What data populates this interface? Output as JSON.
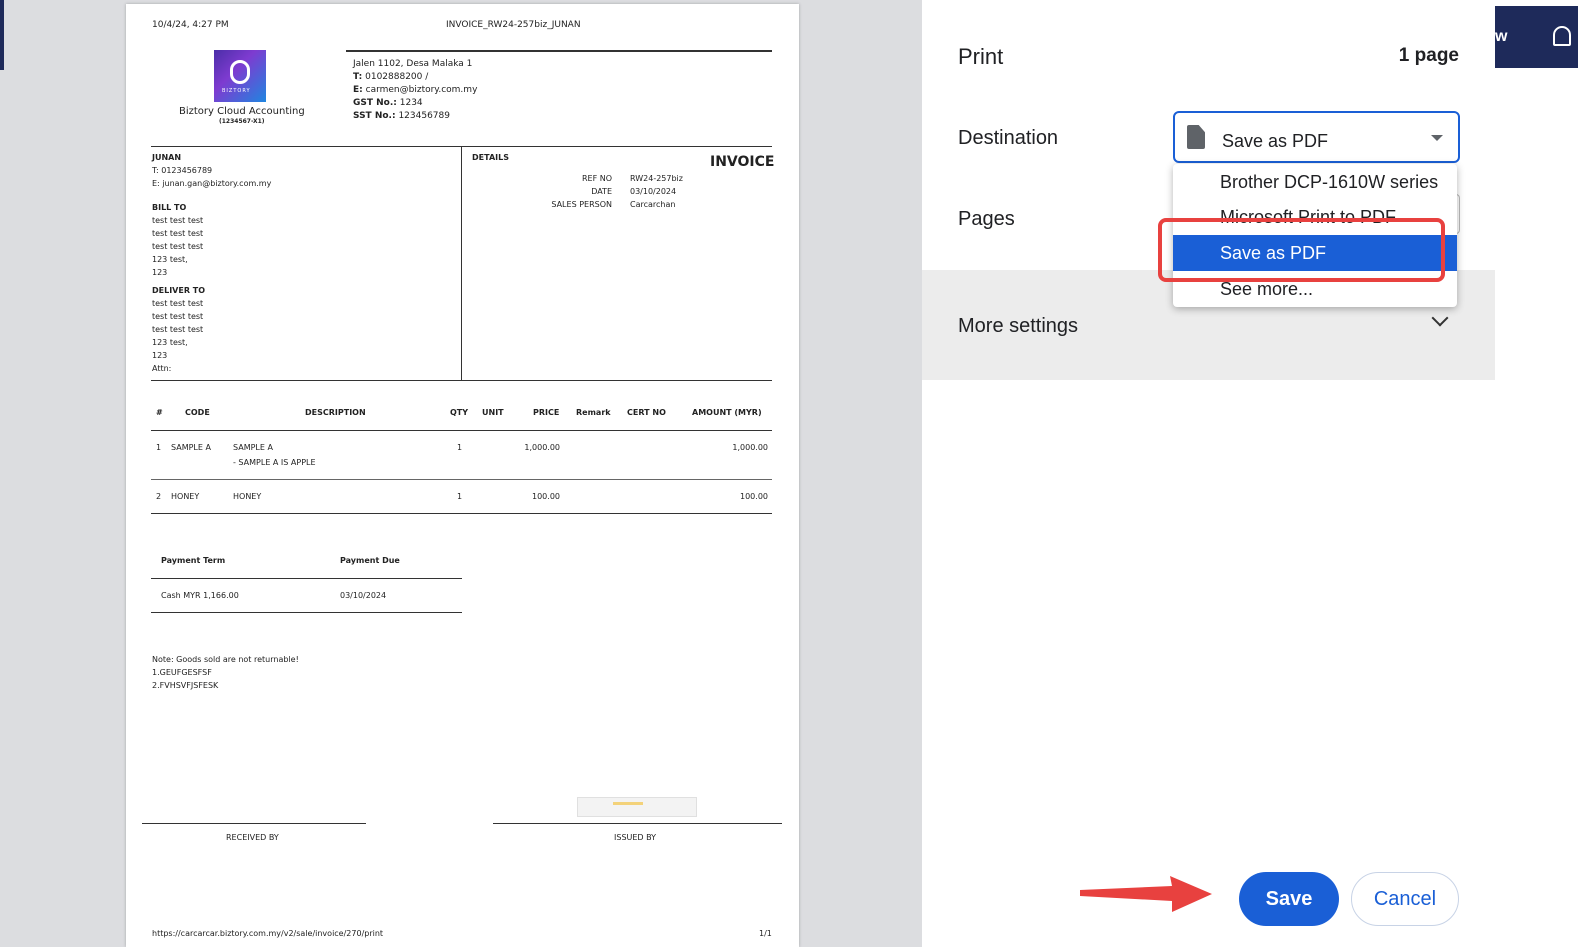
{
  "doc": {
    "header_datetime": "10/4/24, 4:27 PM",
    "header_title": "INVOICE_RW24-257biz_JUNAN",
    "logo_text": "BIZTORY",
    "company_name": "Biztory Cloud Accounting",
    "company_reg": "(1234567-X1)",
    "address": "Jalen 1102, Desa Malaka 1",
    "phone_label": "T:",
    "phone": "0102888200 /",
    "email_label": "E:",
    "email": "carmen@biztory.com.my",
    "gst_label": "GST No.:",
    "gst": "1234",
    "sst_label": "SST No.:",
    "sst": "123456789",
    "customer_name": "JUNAN",
    "customer_phone": "T: 0123456789",
    "customer_email": "E: junan.gan@biztory.com.my",
    "bill_to_label": "BILL TO",
    "bill_to": [
      "test test test",
      "test test test",
      "test test test",
      "123 test,",
      "123"
    ],
    "deliver_to_label": "DELIVER TO",
    "deliver_to": [
      "test test test",
      "test test test",
      "test test test",
      "123 test,",
      "123",
      "Attn:"
    ],
    "details_label": "DETAILS",
    "invoice_title": "INVOICE",
    "ref_label": "REF NO",
    "ref": "RW24-257biz",
    "date_label": "DATE",
    "date": "03/10/2024",
    "sales_label": "SALES PERSON",
    "sales": "Carcarchan",
    "columns": {
      "num": "#",
      "code": "CODE",
      "desc": "DESCRIPTION",
      "qty": "QTY",
      "unit": "UNIT",
      "price": "PRICE",
      "remark": "Remark",
      "cert": "CERT NO",
      "amount": "AMOUNT (MYR)"
    },
    "items": [
      {
        "num": "1",
        "code": "SAMPLE A",
        "desc": "SAMPLE A",
        "desc2": "- SAMPLE A IS APPLE",
        "qty": "1",
        "price": "1,000.00",
        "amount": "1,000.00"
      },
      {
        "num": "2",
        "code": "HONEY",
        "desc": "HONEY",
        "desc2": "",
        "qty": "1",
        "price": "100.00",
        "amount": "100.00"
      }
    ],
    "payment_term_label": "Payment Term",
    "payment_due_label": "Payment Due",
    "payment_term": "Cash MYR 1,166.00",
    "payment_due": "03/10/2024",
    "notes": [
      "Note: Goods sold are not returnable!",
      "1.GEUFGESFSF",
      "2.FVHSVFJSFESK"
    ],
    "received_by": "RECEIVED BY",
    "issued_by": "ISSUED BY",
    "footer_url": "https://carcarcar.biztory.com.my/v2/sale/invoice/270/print",
    "footer_page": "1/1"
  },
  "panel": {
    "title": "Print",
    "page_count": "1 page",
    "destination_label": "Destination",
    "destination_value": "Save as PDF",
    "pages_label": "Pages",
    "more_settings_label": "More settings",
    "dropdown_options": [
      "Brother DCP-1610W series",
      "Microsoft Print to PDF",
      "Save as PDF",
      "See more..."
    ],
    "save_label": "Save",
    "cancel_label": "Cancel"
  },
  "app_bar": {
    "partial_text": "w"
  },
  "colors": {
    "accent": "#1a5fd6",
    "highlight_red": "#e8413f",
    "app_navy": "#1e2a5a"
  }
}
